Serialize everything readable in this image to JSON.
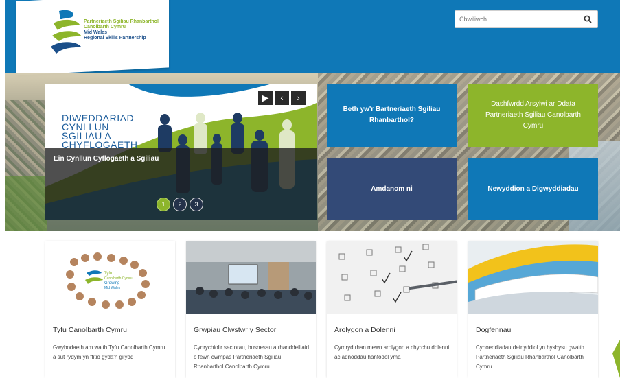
{
  "header": {
    "logo": {
      "line_cy_1": "Partneriaeth Sgiliau Rhanbarthol",
      "line_cy_2": "Canolbarth Cymru",
      "line_en_1": "Mid Wales",
      "line_en_2": "Regional Skills Partnership"
    },
    "search": {
      "placeholder": "Chwiliwch..."
    }
  },
  "slider": {
    "slide_title_lines": [
      "DIWEDDARIAD",
      "CYNLLUN",
      "SGILIAU A",
      "CHYFLOGAETH"
    ],
    "caption": "Ein Cynllun Cyflogaeth a Sgiliau",
    "controls": {
      "play": "▶",
      "prev": "‹",
      "next": "›"
    },
    "pages": [
      "1",
      "2",
      "3"
    ],
    "active_page": "1"
  },
  "tiles": [
    {
      "label": "Beth yw'r Bartneriaeth Sgiliau Rhanbarthol?",
      "color": "#0f78b7"
    },
    {
      "label": "Dashfwrdd Arsylwi ar Ddata Partneriaeth Sgiliau Canolbarth Cymru",
      "color": "#8db52b"
    },
    {
      "label": "Amdanom ni",
      "color": "#334a77"
    },
    {
      "label": "Newyddion a Digwyddiadau",
      "color": "#0f78b7"
    }
  ],
  "cards": [
    {
      "title": "Tyfu Canolbarth Cymru",
      "desc": "Gwybodaeth am waith Tyfu Canolbarth Cymru a sut rydym yn ffitio gyda'n gilydd",
      "img_text_1": "Tyfu",
      "img_text_2": "Canolbarth Cymru",
      "img_text_3": "Growing",
      "img_text_4": "Mid Wales"
    },
    {
      "title": "Grwpiau Clwstwr y Sector",
      "desc": "Cynrychiolir sectorau, busnesau a rhanddeiliaid o fewn cwmpas Partneriaeth Sgiliau Rhanbarthol Canolbarth Cymru"
    },
    {
      "title": "Arolygon a Dolenni",
      "desc": "Cymryd rhan mewn arolygon a chyrchu dolenni ac adnoddau hanfodol yma"
    },
    {
      "title": "Dogfennau",
      "desc": "Cyhoeddiadau defnyddiol yn hysbysu gwaith Partneriaeth Sgiliau Rhanbarthol Canolbarth Cymru"
    }
  ],
  "colors": {
    "brand_blue": "#0f78b7",
    "brand_green": "#8db52b",
    "navy": "#334a77"
  }
}
